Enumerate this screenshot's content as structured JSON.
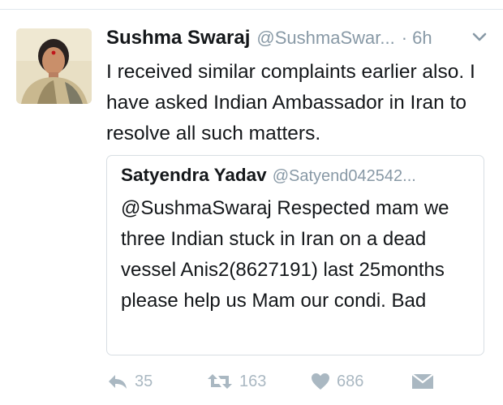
{
  "tweet": {
    "author_name": "Sushma Swaraj",
    "author_handle": "@SushmaSwar...",
    "timestamp": "· 6h",
    "text": "I received similar complaints earlier also. I have asked Indian Ambassador in Iran to resolve all such matters."
  },
  "quoted_tweet": {
    "author_name": "Satyendra Yadav",
    "author_handle": "@Satyend042542...",
    "text": "@SushmaSwaraj Respected mam we three Indian stuck in Iran on a dead vessel Anis2(8627191) last 25months please help us Mam our condi. Bad"
  },
  "actions": {
    "reply_count": "35",
    "retweet_count": "163",
    "like_count": "686"
  },
  "icons": {
    "menu": "chevron-down-icon",
    "reply": "reply-icon",
    "retweet": "retweet-icon",
    "like": "heart-icon",
    "message": "envelope-icon"
  },
  "colors": {
    "text": "#14171a",
    "secondary": "#8899a6",
    "action_gray": "#aab8c2",
    "border": "#d8dee3"
  }
}
